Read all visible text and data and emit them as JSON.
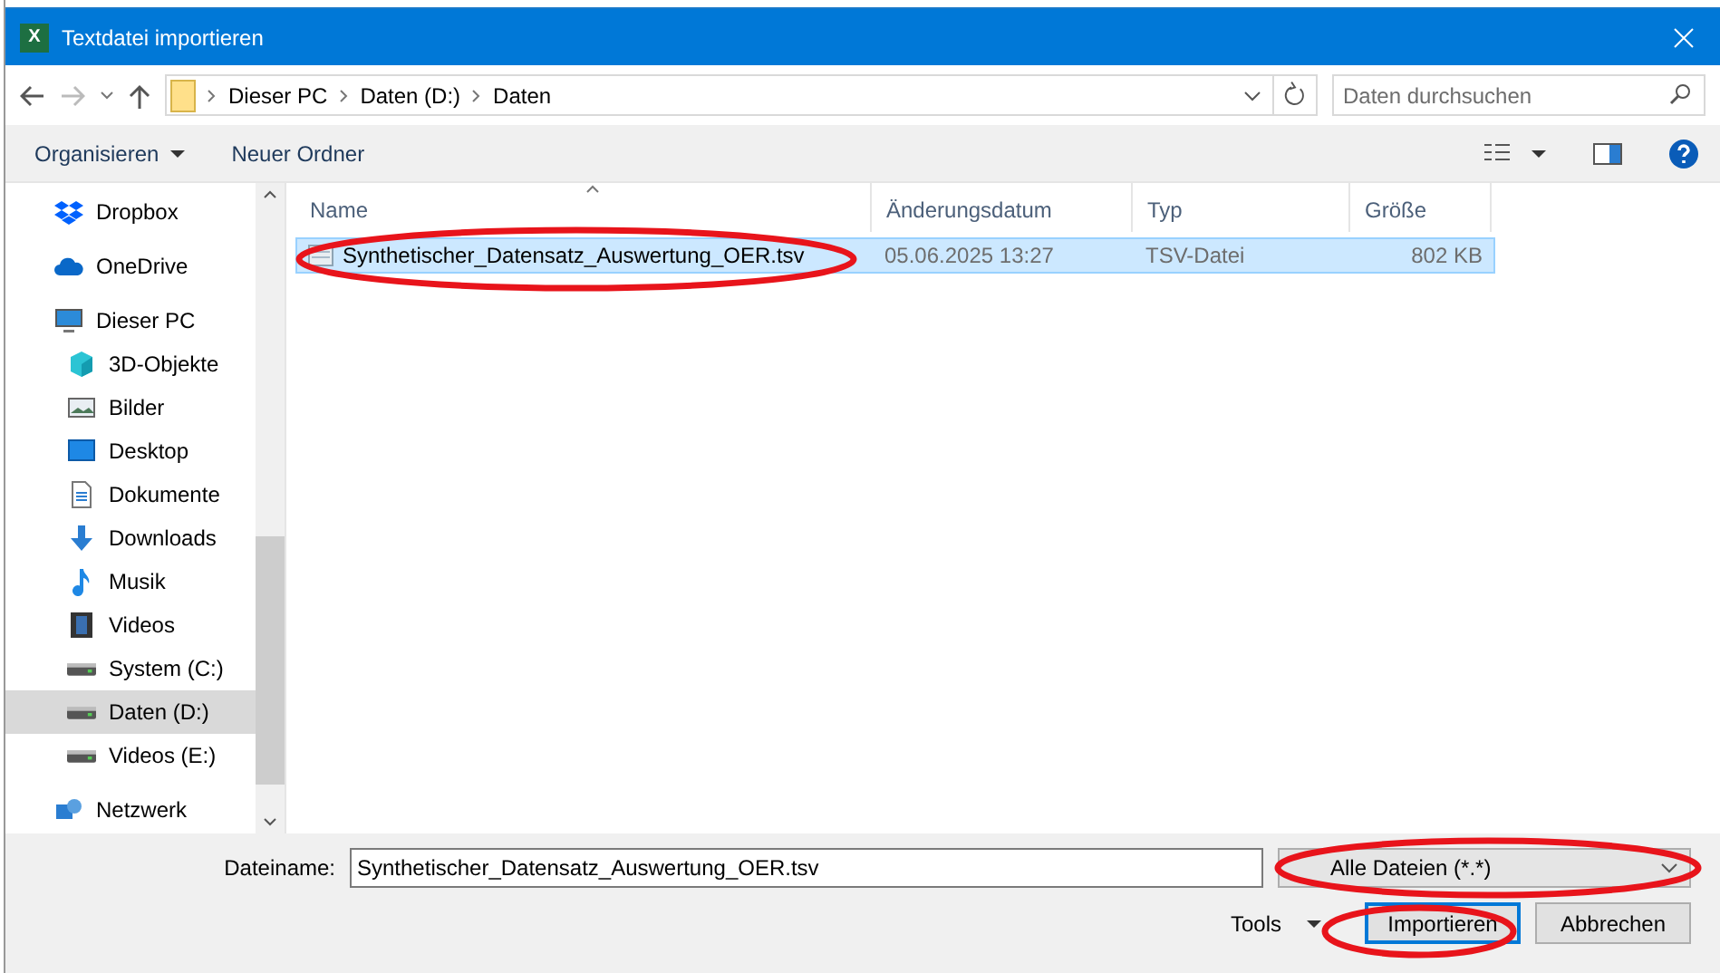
{
  "window": {
    "title": "Textdatei importieren",
    "app_icon": "X"
  },
  "address": {
    "path": [
      "Dieser PC",
      "Daten (D:)",
      "Daten"
    ],
    "search_placeholder": "Daten durchsuchen"
  },
  "toolbar": {
    "organize": "Organisieren",
    "new_folder": "Neuer Ordner"
  },
  "sidebar": {
    "items": [
      {
        "label": "Dropbox",
        "kind": "dropbox",
        "selected": false
      },
      {
        "label": "OneDrive",
        "kind": "cloud",
        "selected": false
      },
      {
        "label": "Dieser PC",
        "kind": "pc",
        "selected": false,
        "children": [
          {
            "label": "3D-Objekte",
            "kind": "cube",
            "selected": false
          },
          {
            "label": "Bilder",
            "kind": "picture",
            "selected": false
          },
          {
            "label": "Desktop",
            "kind": "desktop",
            "selected": false
          },
          {
            "label": "Dokumente",
            "kind": "document",
            "selected": false
          },
          {
            "label": "Downloads",
            "kind": "download",
            "selected": false
          },
          {
            "label": "Musik",
            "kind": "music",
            "selected": false
          },
          {
            "label": "Videos",
            "kind": "film",
            "selected": false
          },
          {
            "label": "System (C:)",
            "kind": "drive",
            "selected": false
          },
          {
            "label": "Daten (D:)",
            "kind": "drive",
            "selected": true
          },
          {
            "label": "Videos (E:)",
            "kind": "drive",
            "selected": false
          }
        ]
      },
      {
        "label": "Netzwerk",
        "kind": "network",
        "selected": false
      }
    ]
  },
  "table": {
    "columns": [
      "Name",
      "Änderungsdatum",
      "Typ",
      "Größe"
    ],
    "rows": [
      {
        "name": "Synthetischer_Datensatz_Auswertung_OER.tsv",
        "date": "05.06.2025 13:27",
        "type": "TSV-Datei",
        "size": "802 KB",
        "selected": true,
        "circled": true
      }
    ]
  },
  "footer": {
    "filename_label": "Dateiname:",
    "filename": "Synthetischer_Datensatz_Auswertung_OER.tsv",
    "filter": "Alle Dateien (*.*)",
    "filter_circled": true,
    "tools": "Tools",
    "import": "Importieren",
    "import_circled": true,
    "cancel": "Abbrechen"
  }
}
